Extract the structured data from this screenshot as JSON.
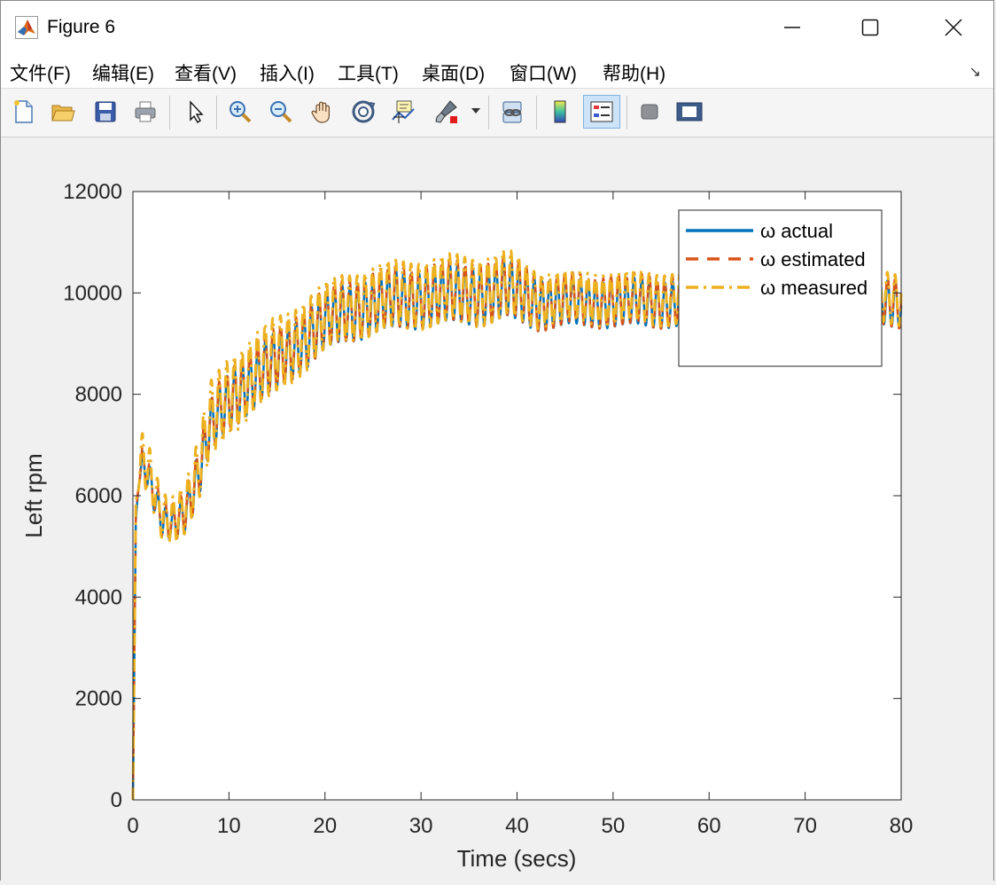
{
  "window": {
    "title": "Figure 6",
    "minimize_icon": "minimize-icon",
    "maximize_icon": "maximize-icon",
    "close_icon": "close-icon"
  },
  "menu": {
    "items": [
      "文件(F)",
      "编辑(E)",
      "查看(V)",
      "插入(I)",
      "工具(T)",
      "桌面(D)",
      "窗口(W)",
      "帮助(H)"
    ],
    "overflow_icon": "menu-overflow-arrow-icon"
  },
  "toolbar": {
    "tools": [
      {
        "name": "new-figure",
        "icon": "new-file-icon"
      },
      {
        "name": "open-file",
        "icon": "open-folder-icon"
      },
      {
        "name": "save-figure",
        "icon": "save-disk-icon"
      },
      {
        "name": "print-figure",
        "icon": "printer-icon"
      },
      {
        "name": "edit-plot",
        "icon": "pointer-arrow-icon"
      },
      {
        "name": "zoom-in",
        "icon": "zoom-in-icon"
      },
      {
        "name": "zoom-out",
        "icon": "zoom-out-icon"
      },
      {
        "name": "pan",
        "icon": "hand-pan-icon"
      },
      {
        "name": "rotate-3d",
        "icon": "rotate-3d-icon"
      },
      {
        "name": "data-cursor",
        "icon": "data-tip-icon"
      },
      {
        "name": "brush",
        "icon": "brush-icon"
      },
      {
        "name": "link-plot",
        "icon": "link-plot-icon"
      },
      {
        "name": "insert-colorbar",
        "icon": "colorbar-icon"
      },
      {
        "name": "insert-legend",
        "icon": "legend-icon"
      },
      {
        "name": "hide-plot-tools",
        "icon": "hide-plot-tools-icon"
      },
      {
        "name": "show-plot-tools",
        "icon": "show-plot-tools-icon"
      }
    ],
    "active": "insert-legend"
  },
  "chart_data": {
    "type": "line",
    "xlabel": "Time (secs)",
    "ylabel": "Left rpm",
    "xlim": [
      0,
      80
    ],
    "ylim": [
      0,
      12000
    ],
    "xticks": [
      0,
      10,
      20,
      30,
      40,
      50,
      60,
      70,
      80
    ],
    "yticks": [
      0,
      2000,
      4000,
      6000,
      8000,
      10000,
      12000
    ],
    "grid": false,
    "legend_position": "top-right",
    "oscillation_period_secs": 0.8,
    "series": [
      {
        "name": "ω actual",
        "color": "#0072BD",
        "style": "solid",
        "envelope": {
          "x": [
            0,
            0.3,
            0.6,
            1,
            1.5,
            2,
            2.5,
            3,
            4,
            5,
            6,
            7,
            8,
            10,
            12,
            14,
            16,
            18,
            20,
            22,
            24,
            26,
            28,
            30,
            33,
            36,
            39,
            42,
            45,
            50,
            55,
            60,
            65,
            70,
            75,
            80
          ],
          "mean": [
            0,
            5500,
            6300,
            6600,
            6400,
            6100,
            5800,
            5500,
            5450,
            5600,
            5900,
            6500,
            7300,
            7900,
            8200,
            8500,
            8800,
            9100,
            9400,
            9600,
            9700,
            9800,
            9850,
            9900,
            9950,
            9950,
            10050,
            9800,
            9800,
            9800,
            9800,
            9800,
            9800,
            9800,
            9800,
            9800
          ],
          "amplitude": [
            0,
            0,
            100,
            250,
            300,
            300,
            300,
            300,
            300,
            350,
            400,
            450,
            500,
            550,
            550,
            550,
            550,
            550,
            550,
            550,
            550,
            550,
            550,
            550,
            550,
            550,
            550,
            500,
            450,
            450,
            450,
            450,
            450,
            450,
            450,
            450
          ]
        }
      },
      {
        "name": "ω estimated",
        "color": "#D95319",
        "style": "dashed",
        "envelope": {
          "x": [
            0,
            0.3,
            0.6,
            1,
            1.5,
            2,
            2.5,
            3,
            4,
            5,
            6,
            7,
            8,
            10,
            12,
            14,
            16,
            18,
            20,
            22,
            24,
            26,
            28,
            30,
            33,
            36,
            39,
            42,
            45,
            50,
            55,
            60,
            65,
            70,
            75,
            80
          ],
          "mean": [
            0,
            5600,
            6350,
            6650,
            6450,
            6150,
            5850,
            5550,
            5500,
            5650,
            5950,
            6550,
            7350,
            7950,
            8250,
            8550,
            8850,
            9150,
            9450,
            9650,
            9750,
            9850,
            9900,
            9950,
            10000,
            10000,
            10100,
            9850,
            9850,
            9850,
            9850,
            9850,
            9850,
            9850,
            9850,
            9850
          ],
          "amplitude": [
            0,
            0,
            150,
            300,
            350,
            350,
            350,
            350,
            350,
            400,
            450,
            500,
            550,
            600,
            600,
            600,
            600,
            600,
            600,
            600,
            600,
            600,
            600,
            600,
            600,
            600,
            600,
            550,
            500,
            500,
            500,
            500,
            500,
            500,
            500,
            500
          ]
        }
      },
      {
        "name": "ω measured",
        "color": "#EDB120",
        "style": "dashdot",
        "envelope": {
          "x": [
            0,
            0.3,
            0.6,
            1,
            1.5,
            2,
            2.5,
            3,
            4,
            5,
            6,
            7,
            8,
            10,
            12,
            14,
            16,
            18,
            20,
            22,
            24,
            26,
            28,
            30,
            33,
            36,
            39,
            42,
            45,
            50,
            55,
            60,
            65,
            70,
            75,
            80
          ],
          "mean": [
            0,
            5800,
            6500,
            6700,
            6500,
            6200,
            5900,
            5600,
            5550,
            5700,
            6000,
            6600,
            7400,
            8000,
            8300,
            8600,
            8900,
            9200,
            9500,
            9700,
            9800,
            9900,
            9950,
            10000,
            10050,
            10050,
            10150,
            9900,
            9900,
            9900,
            9900,
            9900,
            9900,
            9900,
            9900,
            9900
          ],
          "amplitude": [
            0,
            0,
            400,
            500,
            550,
            500,
            450,
            450,
            450,
            500,
            550,
            650,
            750,
            750,
            750,
            750,
            700,
            700,
            650,
            650,
            650,
            650,
            650,
            650,
            650,
            650,
            650,
            550,
            500,
            500,
            500,
            500,
            500,
            500,
            500,
            500
          ]
        }
      }
    ]
  }
}
